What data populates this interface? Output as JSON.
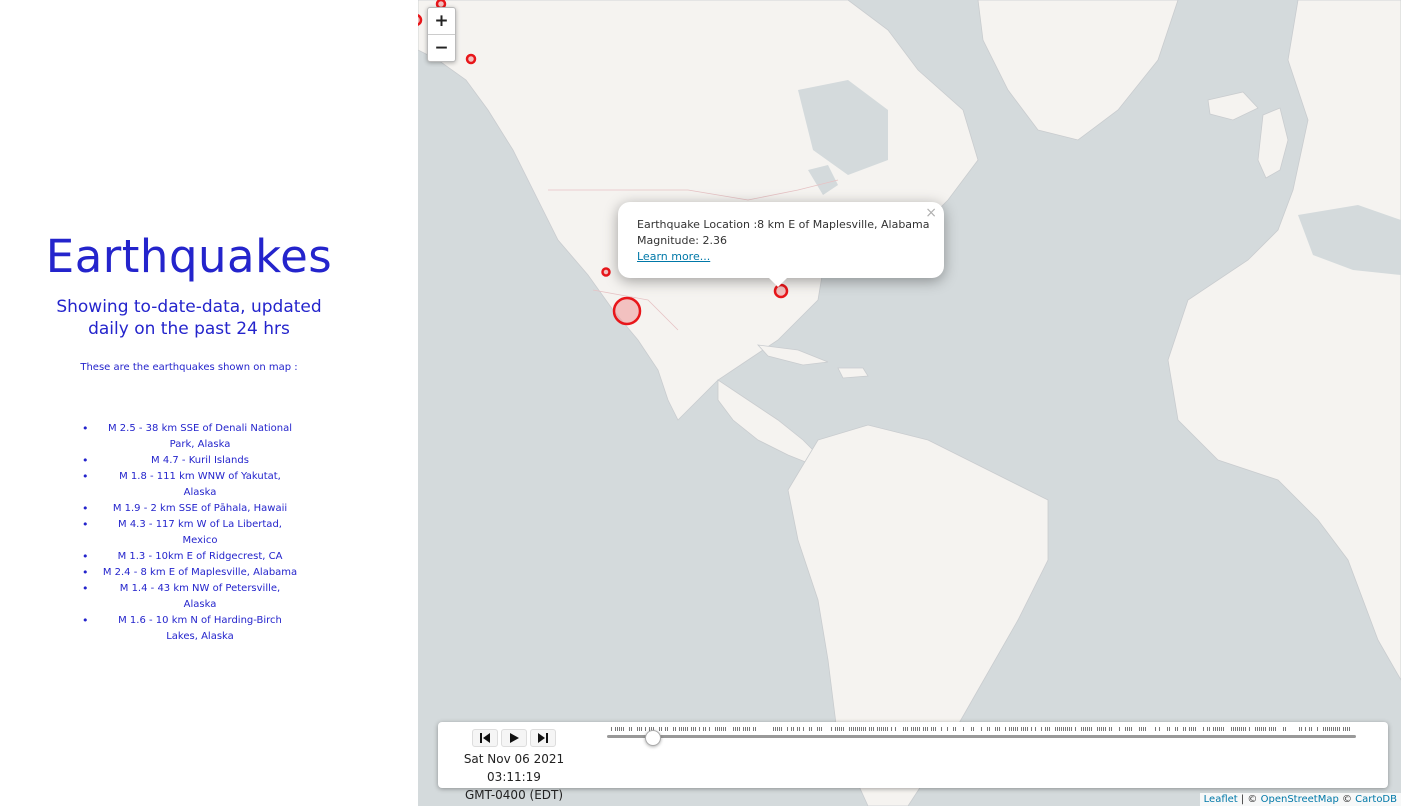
{
  "sidebar": {
    "title": "Earthquakes",
    "subtitle": "Showing to-date-data, updated daily on the past 24 hrs",
    "intro": "These are the earthquakes shown on map :",
    "quakes": [
      "M 2.5 - 38 km SSE of Denali National Park, Alaska",
      "M 4.7 - Kuril Islands",
      "M 1.8 - 111 km WNW of Yakutat, Alaska",
      "M 1.9 - 2 km SSE of Pāhala, Hawaii",
      "M 4.3 - 117 km W of La Libertad, Mexico",
      "M 1.3 - 10km E of Ridgecrest, CA",
      "M 2.4 - 8 km E of Maplesville, Alabama",
      "M 1.4 - 43 km NW of Petersville, Alaska",
      "M 1.6 - 10 km N of Harding-Birch Lakes, Alaska"
    ]
  },
  "map": {
    "zoom_in": "+",
    "zoom_out": "−",
    "marker_color": "#e8161a",
    "popup": {
      "location_line": "Earthquake Location :8 km E of Maplesville, Alabama",
      "magnitude_line": "Magnitude: 2.36",
      "link": "Learn more...",
      "close": "×"
    },
    "timeline": {
      "date_line1": "Sat Nov 06 2021 03:11:19",
      "date_line2": "GMT-0400 (EDT)",
      "position_fraction": 0.06
    },
    "attribution": {
      "leaflet": "Leaflet",
      "sep1": " | © ",
      "osm": "OpenStreetMap",
      "sep2": " © ",
      "carto": "CartoDB"
    }
  }
}
